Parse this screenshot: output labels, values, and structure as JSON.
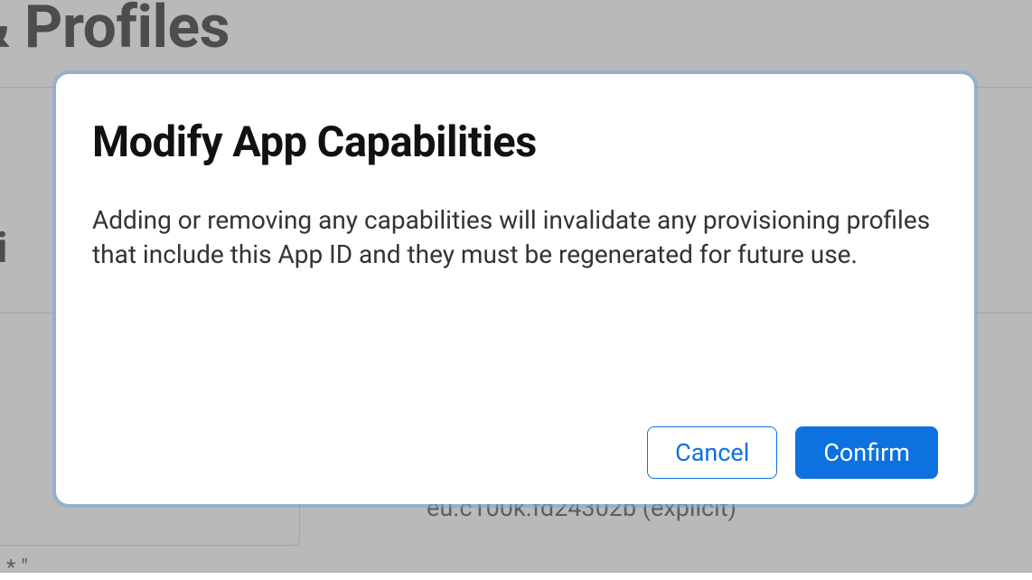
{
  "background": {
    "page_title_fragment": "ers & Profiles",
    "subtitle_fragment": "rati",
    "bundle_id_text": "eu.c100k.fd24302b (explicit)",
    "asterisk_row": "*  \""
  },
  "modal": {
    "title": "Modify App Capabilities",
    "body": "Adding or removing any capabilities will invalidate any provisioning profiles that include this App ID and they must be regenerated for future use.",
    "cancel_label": "Cancel",
    "confirm_label": "Confirm"
  }
}
